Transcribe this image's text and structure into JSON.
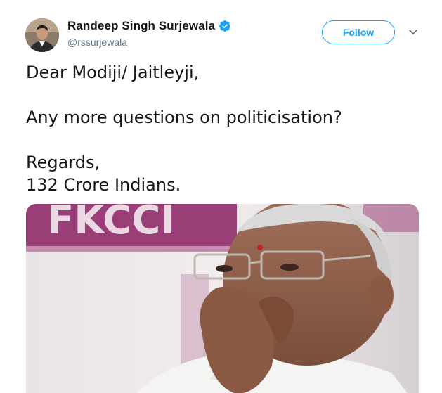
{
  "tweet": {
    "author": {
      "name": "Randeep Singh Surjewala",
      "handle": "@rssurjewala",
      "verified": true,
      "avatar_icon": "profile-photo"
    },
    "follow_label": "Follow",
    "more_icon": "chevron-down-icon",
    "text_lines": [
      "Dear Modiji/ Jaitleyji,",
      "Any more questions on politicisation?",
      "Regards,",
      "132 Crore Indians."
    ],
    "media": {
      "banner_text": "FKCCI"
    }
  },
  "colors": {
    "accent": "#1da1f2",
    "name": "#14171a",
    "handle": "#657786"
  }
}
